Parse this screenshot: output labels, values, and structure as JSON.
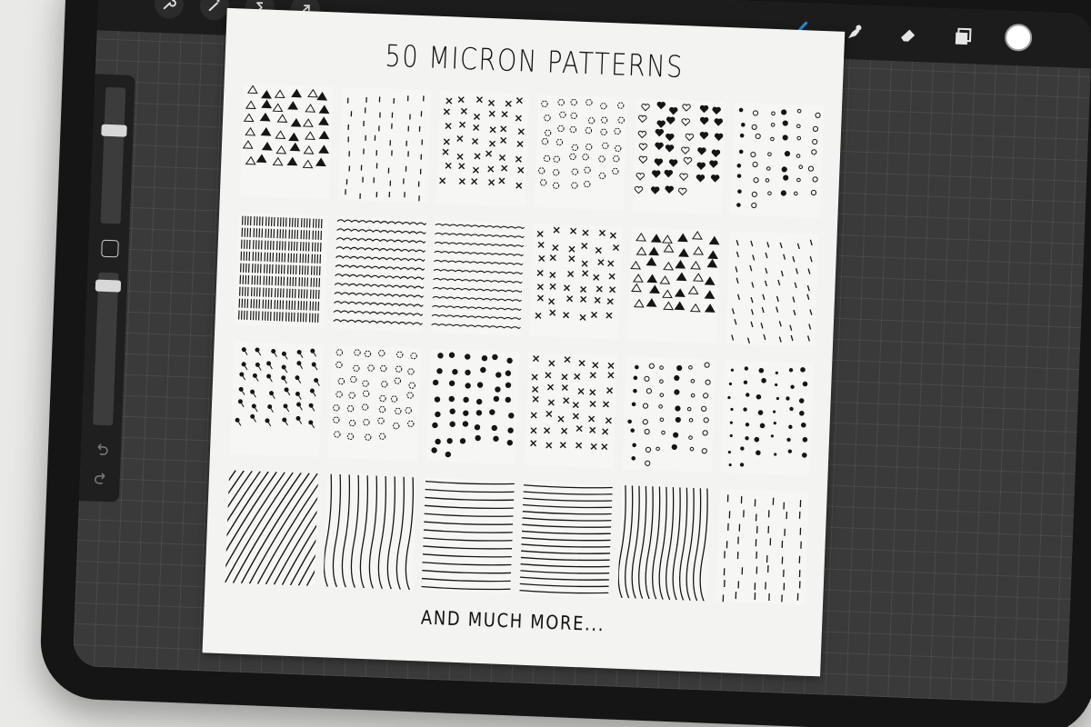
{
  "canvas": {
    "title": "50 MICRON PATTERNS",
    "footer": "AND MUCH MORE..."
  },
  "toolbar": {
    "left_tools": [
      "wrench-icon",
      "magic-wand-icon",
      "selection-s-icon",
      "arrow-icon"
    ],
    "right_tools": [
      "brush-icon",
      "smudge-icon",
      "eraser-icon",
      "layers-icon"
    ],
    "active_tool": "brush-icon",
    "active_color": "#1e8fe6",
    "current_color": "#ffffff"
  },
  "sidebar": {
    "size_slider_level": 0.3,
    "opacity_slider_level": 0.05,
    "buttons": [
      "modify-square-icon",
      "undo-icon",
      "redo-icon"
    ]
  },
  "patterns": [
    "triangles-striped",
    "dashes",
    "crosses-small",
    "squiggles-letters",
    "hearts",
    "dots-circles",
    "hatched-squares",
    "loops-rows",
    "waves",
    "x-marks",
    "triangles-dots",
    "short-dashes",
    "lollipops",
    "flowers",
    "blobs",
    "stars",
    "circles-dots",
    "dots-scatter",
    "diagonal-lines",
    "vertical-wavy",
    "horizontal-lines",
    "horizontal-dense",
    "vertical-dense",
    "dash-columns"
  ]
}
